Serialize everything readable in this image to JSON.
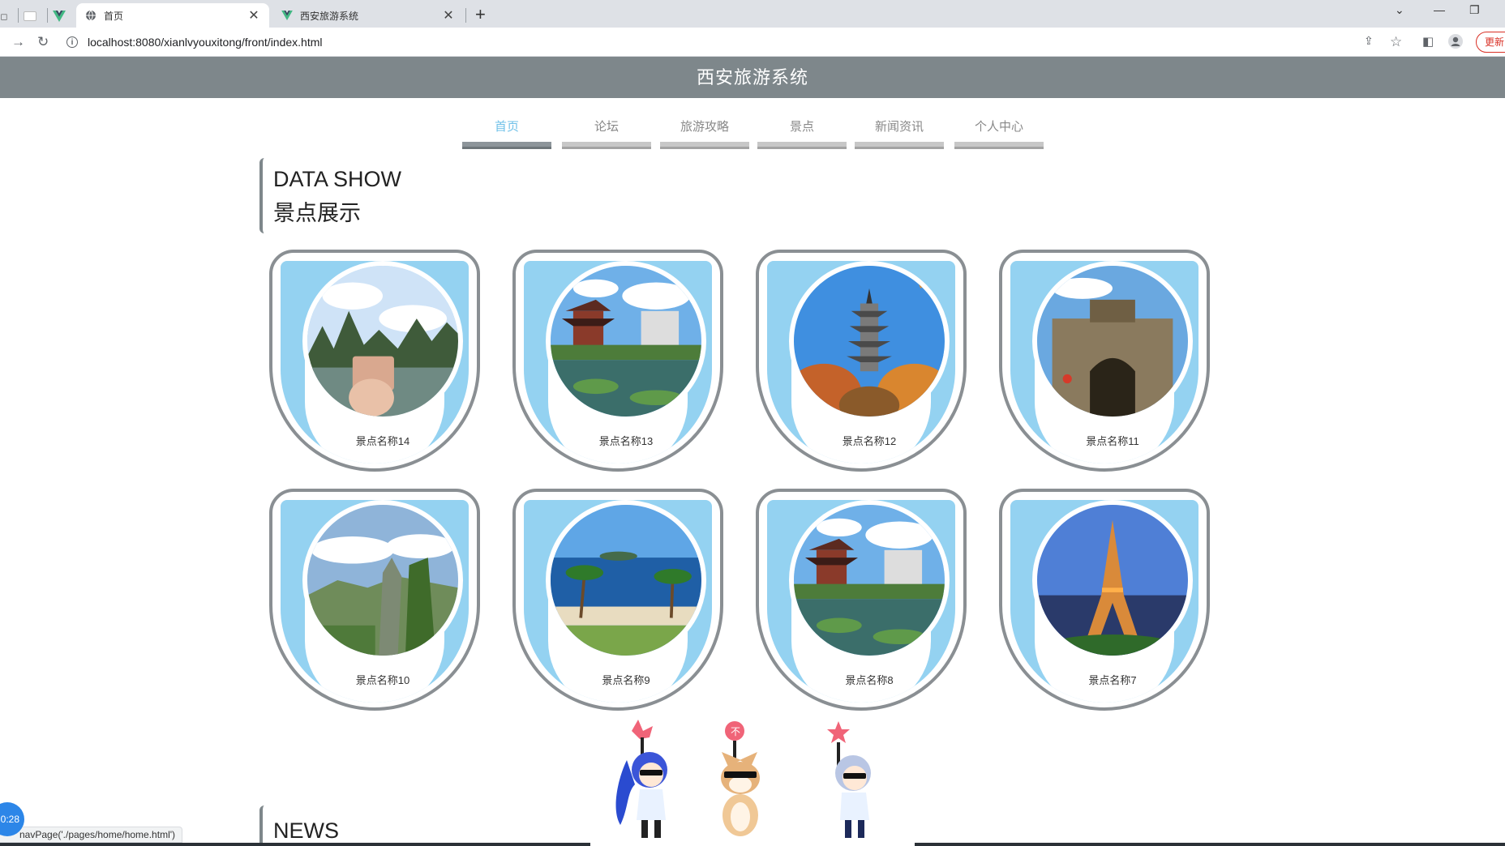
{
  "browser": {
    "tabs": [
      {
        "title": "首页",
        "active": true,
        "icon": "globe-icon"
      },
      {
        "title": "西安旅游系统",
        "active": false,
        "icon": "vue-logo-icon"
      }
    ],
    "address": "localhost:8080/xianlvyouxitong/front/index.html",
    "update_label": "更新",
    "status_link": "navPage('./pages/home/home.html')",
    "timer": "0:28"
  },
  "site": {
    "title": "西安旅游系统",
    "nav": [
      {
        "label": "首页",
        "active": true
      },
      {
        "label": "论坛",
        "active": false
      },
      {
        "label": "旅游攻略",
        "active": false
      },
      {
        "label": "景点",
        "active": false
      },
      {
        "label": "新闻资讯",
        "active": false
      },
      {
        "label": "个人中心",
        "active": false
      }
    ]
  },
  "data_show": {
    "title_en": "DATA SHOW",
    "title_cn": "景点展示",
    "items": [
      {
        "name": "景点名称14",
        "scene": "karst-river"
      },
      {
        "name": "景点名称13",
        "scene": "pagoda-lake"
      },
      {
        "name": "景点名称12",
        "scene": "tower-autumn"
      },
      {
        "name": "景点名称11",
        "scene": "old-gate"
      },
      {
        "name": "景点名称10",
        "scene": "cliff-valley"
      },
      {
        "name": "景点名称9",
        "scene": "beach-palms"
      },
      {
        "name": "景点名称8",
        "scene": "pagoda-lake"
      },
      {
        "name": "景点名称7",
        "scene": "eiffel-tower"
      }
    ]
  },
  "news": {
    "title_en": "NEWS"
  },
  "colors": {
    "header_bg": "#7e878b",
    "nav_active": "#6fc0e8",
    "card_blue": "#94d2f1",
    "card_border": "#8a8f93"
  }
}
